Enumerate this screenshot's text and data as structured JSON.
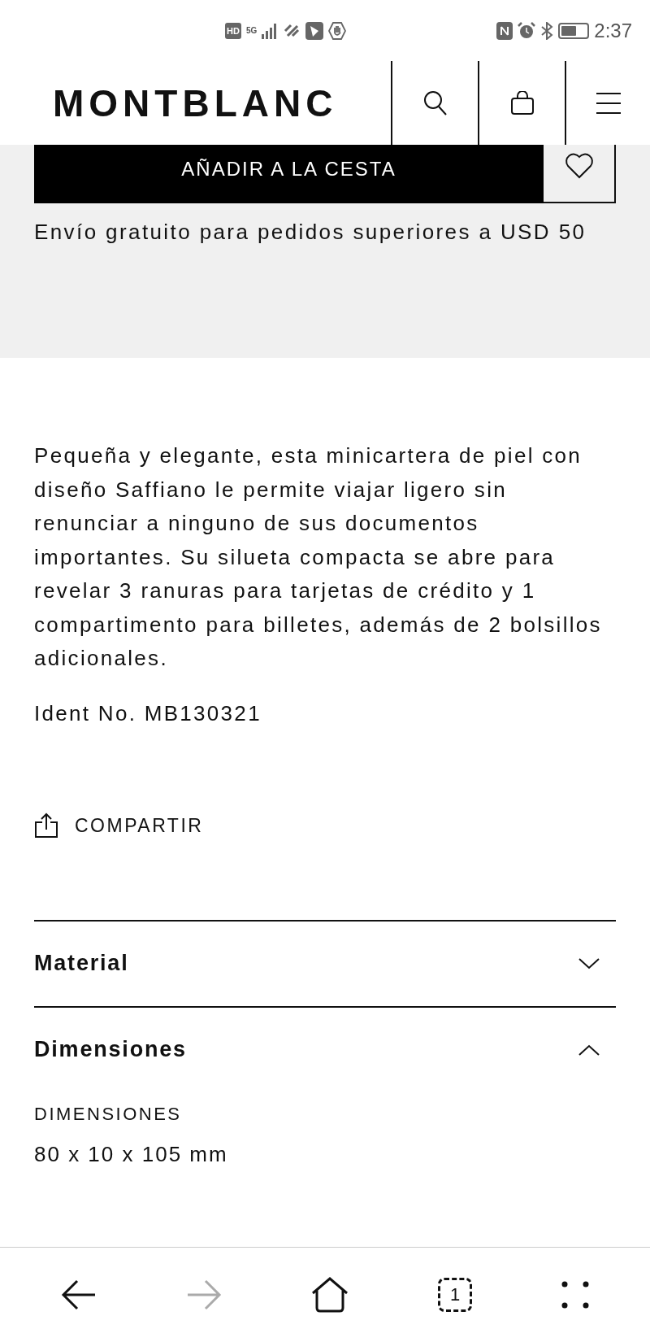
{
  "status_bar": {
    "hd": "HD",
    "network": "5G",
    "time": "2:37"
  },
  "header": {
    "logo": "MONTBLANC"
  },
  "purchase": {
    "add_to_cart": "AÑADIR A LA CESTA",
    "wishlisted": false,
    "shipping_note": "Envío gratuito para pedidos superiores a USD 50"
  },
  "description": "Pequeña y elegante, esta minicartera de piel con diseño Saffiano le permite viajar ligero sin renunciar a ninguno de sus documentos importantes. Su silueta compacta se abre para revelar 3 ranuras para tarjetas de crédito y 1 compartimento para billetes, además de 2 bolsillos adicionales.",
  "ident": "Ident No. MB130321",
  "share": "COMPARTIR",
  "accordion": [
    {
      "title": "Material",
      "expanded": false
    },
    {
      "title": "Dimensiones",
      "expanded": true,
      "fields": [
        {
          "label": "DIMENSIONES",
          "value": "80 x 10 x 105 mm"
        }
      ]
    }
  ],
  "bottom_nav": {
    "back_enabled": true,
    "forward_enabled": false,
    "tab_count": "1"
  }
}
